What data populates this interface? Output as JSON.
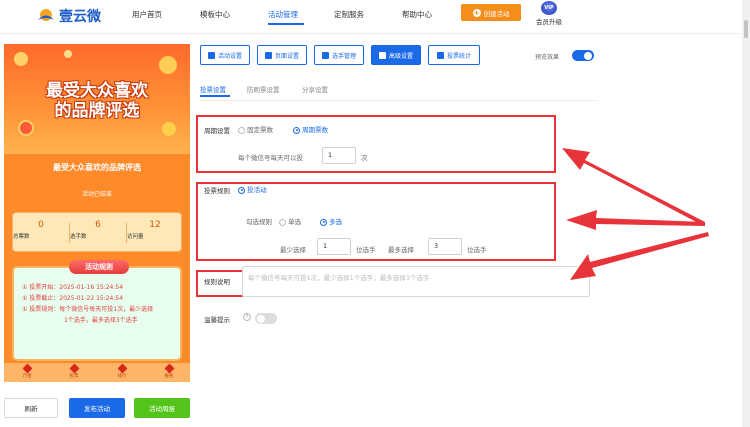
{
  "nav": {
    "logo_text": "壹云微",
    "items": [
      "用户首页",
      "模板中心",
      "活动管理",
      "定制服务",
      "帮助中心"
    ],
    "create_label": "创建活动",
    "vip_badge": "VIP",
    "vip_label": "会员升级"
  },
  "phone": {
    "banner_line1": "最受大众喜欢",
    "banner_line2": "的品牌评选",
    "title": "最受大众喜欢的品牌评选",
    "status": "活动已结束",
    "stats": [
      {
        "num": "0",
        "label": "总票数"
      },
      {
        "num": "6",
        "label": "选手数"
      },
      {
        "num": "12",
        "label": "访问量"
      }
    ],
    "rules_title": "活动规则",
    "rules": [
      "① 投票开始：2025-01-16 15:24:54",
      "① 投票截止：2025-01-22 15:24:54",
      "① 投票规则：每个微信号每天可投1次，最少选择",
      "1个选手，最多选择3个选手"
    ],
    "bottom_nav": [
      "介绍",
      "投票",
      "排行",
      "报名"
    ]
  },
  "bottom_buttons": {
    "refresh": "刷新",
    "publish": "发布活动",
    "activity_review": "活动周报"
  },
  "tabs": [
    "活动设置",
    "页面设置",
    "选手管理",
    "高级设置",
    "投票统计"
  ],
  "preview": {
    "label": "预览效果",
    "on": true
  },
  "subtabs": [
    "投票设置",
    "防刷票设置",
    "分享设置"
  ],
  "cycle": {
    "label": "周期设置",
    "options": [
      "固定票数",
      "周期票数"
    ],
    "selected": 1,
    "per_day_label": "每个微信号每天可以投",
    "per_day_value": "1",
    "unit": "次"
  },
  "vote_rule": {
    "label": "投票规则",
    "option": "投活动",
    "select_label": "勾选规则",
    "select_options": [
      "单选",
      "多选"
    ],
    "selected": 1,
    "min_label": "最少选择",
    "min_value": "1",
    "min_unit": "位选手",
    "max_label": "最多选择",
    "max_value": "3",
    "max_unit": "位选手"
  },
  "rule_desc": {
    "label": "规则说明",
    "placeholder": "每个微信号每天可投1次，最少选择1个选手，最多选择3个选手"
  },
  "tip": {
    "label": "温馨提示",
    "on": false
  },
  "colors": {
    "accent": "#1a6ae8",
    "orange": "#f58d19",
    "green": "#52c41a",
    "red_box": "#e8333a"
  }
}
